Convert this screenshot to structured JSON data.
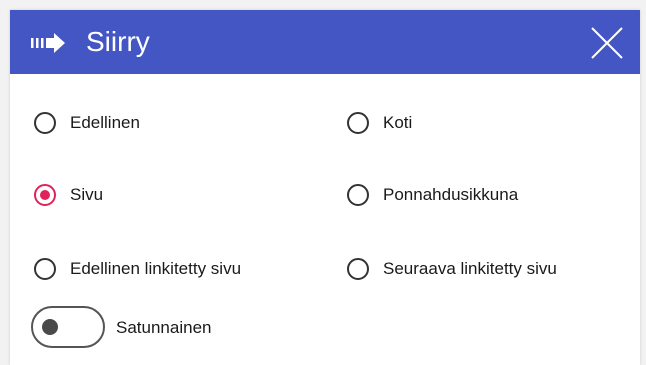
{
  "dialog": {
    "title": "Siirry",
    "icon": "arrow-right-icon",
    "close_icon": "close-icon",
    "header_color": "#4356c4",
    "accent_color": "#e0235c"
  },
  "options": [
    {
      "label": "Edellinen",
      "checked": false
    },
    {
      "label": "Koti",
      "checked": false
    },
    {
      "label": "Sivu",
      "checked": true
    },
    {
      "label": "Ponnahdusikkuna",
      "checked": false
    },
    {
      "label": "Edellinen linkitetty sivu",
      "checked": false
    },
    {
      "label": "Seuraava linkitetty sivu",
      "checked": false
    }
  ],
  "random_toggle": {
    "label": "Satunnainen",
    "on": false
  }
}
